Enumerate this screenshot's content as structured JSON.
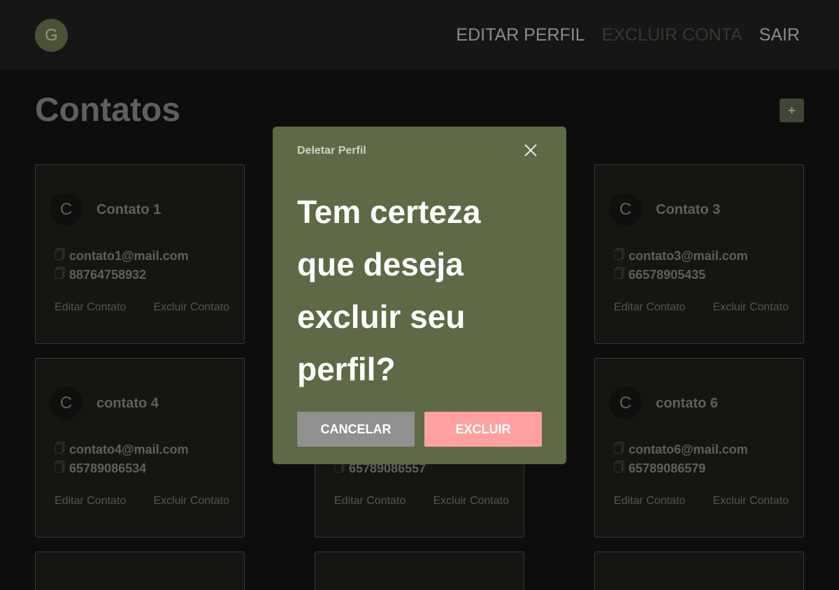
{
  "header": {
    "avatar_initial": "G",
    "nav": {
      "edit_profile": "EDITAR PERFIL",
      "delete_account": "EXCLUIR CONTA",
      "logout": "SAIR"
    }
  },
  "page": {
    "title": "Contatos",
    "add_icon": "+"
  },
  "cards": [
    {
      "initial": "C",
      "name": "Contato 1",
      "email": "contato1@mail.com",
      "phone": "88764758932",
      "edit": "Editar Contato",
      "delete": "Excluir Contato"
    },
    {
      "initial": "C",
      "name": "Contato 3",
      "email": "contato3@mail.com",
      "phone": "66578905435",
      "edit": "Editar Contato",
      "delete": "Excluir Contato"
    },
    {
      "initial": "C",
      "name": "contato 4",
      "email": "contato4@mail.com",
      "phone": "65789086534",
      "edit": "Editar Contato",
      "delete": "Excluir Contato"
    },
    {
      "phone": "65789086557",
      "edit": "Editar Contato",
      "delete": "Excluir Contato"
    },
    {
      "initial": "C",
      "name": "contato 6",
      "email": "contato6@mail.com",
      "phone": "65789086579",
      "edit": "Editar Contato",
      "delete": "Excluir Contato"
    }
  ],
  "copy_glyph": "🗍",
  "modal": {
    "title": "Deletar Perfil",
    "question": "Tem certeza que deseja excluir seu perfil?",
    "cancel_label": "CANCELAR",
    "confirm_label": "EXCLUIR"
  },
  "colors": {
    "modal_bg": "#5e6a46",
    "cancel_bg": "#909090",
    "confirm_bg": "#ffa1a1",
    "accent": "#4a5236"
  }
}
